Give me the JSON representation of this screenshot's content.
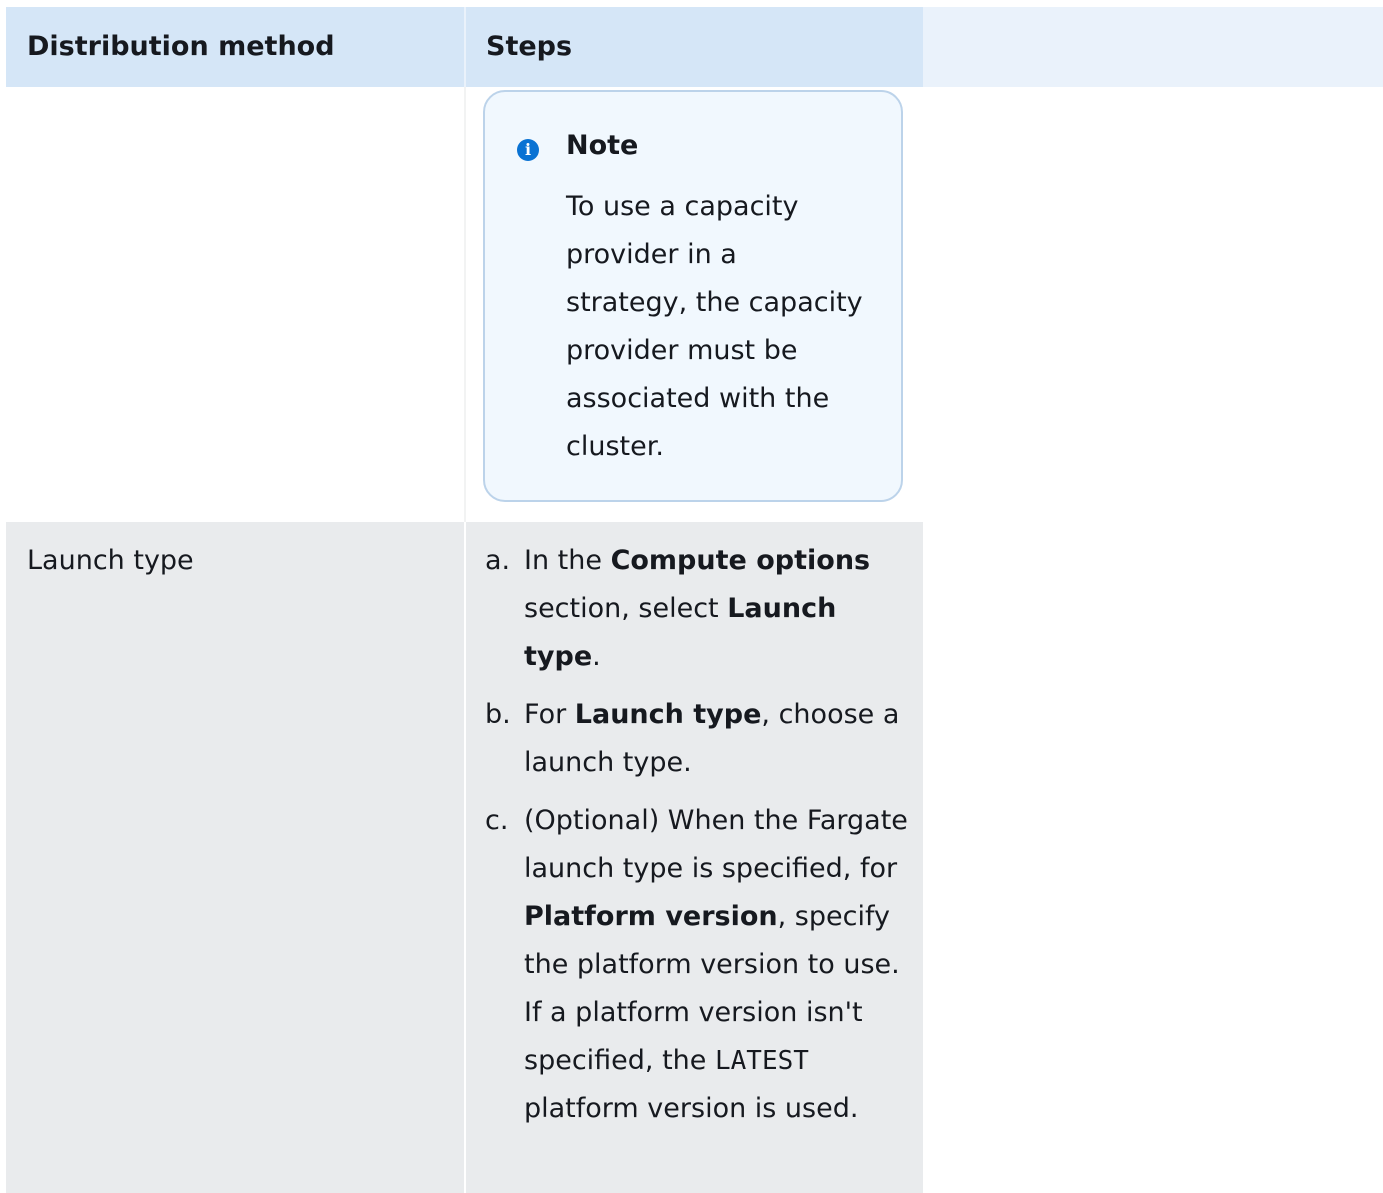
{
  "table": {
    "headers": {
      "method": "Distribution method",
      "steps": "Steps"
    },
    "note": {
      "icon": "info-icon",
      "icon_glyph": "i",
      "title": "Note",
      "body": "To use a capacity provider in a strategy, the capacity provider must be associated with the cluster."
    },
    "launch_row": {
      "method": "Launch type",
      "steps": [
        {
          "marker": "a.",
          "t1": "In the ",
          "b1": "Compute options",
          "t2": " section, select ",
          "b2": "Launch type",
          "t3": "."
        },
        {
          "marker": "b.",
          "t1": "For ",
          "b1": "Launch type",
          "t2": ", choose a launch type."
        },
        {
          "marker": "c.",
          "t1": "(Optional) When the Fargate launch type is specified, for ",
          "b1": "Platform version",
          "t2": ", specify the platform version to use. If a platform version isn't specified, the ",
          "code": "LATEST",
          "t3": " platform version is used."
        }
      ]
    }
  }
}
